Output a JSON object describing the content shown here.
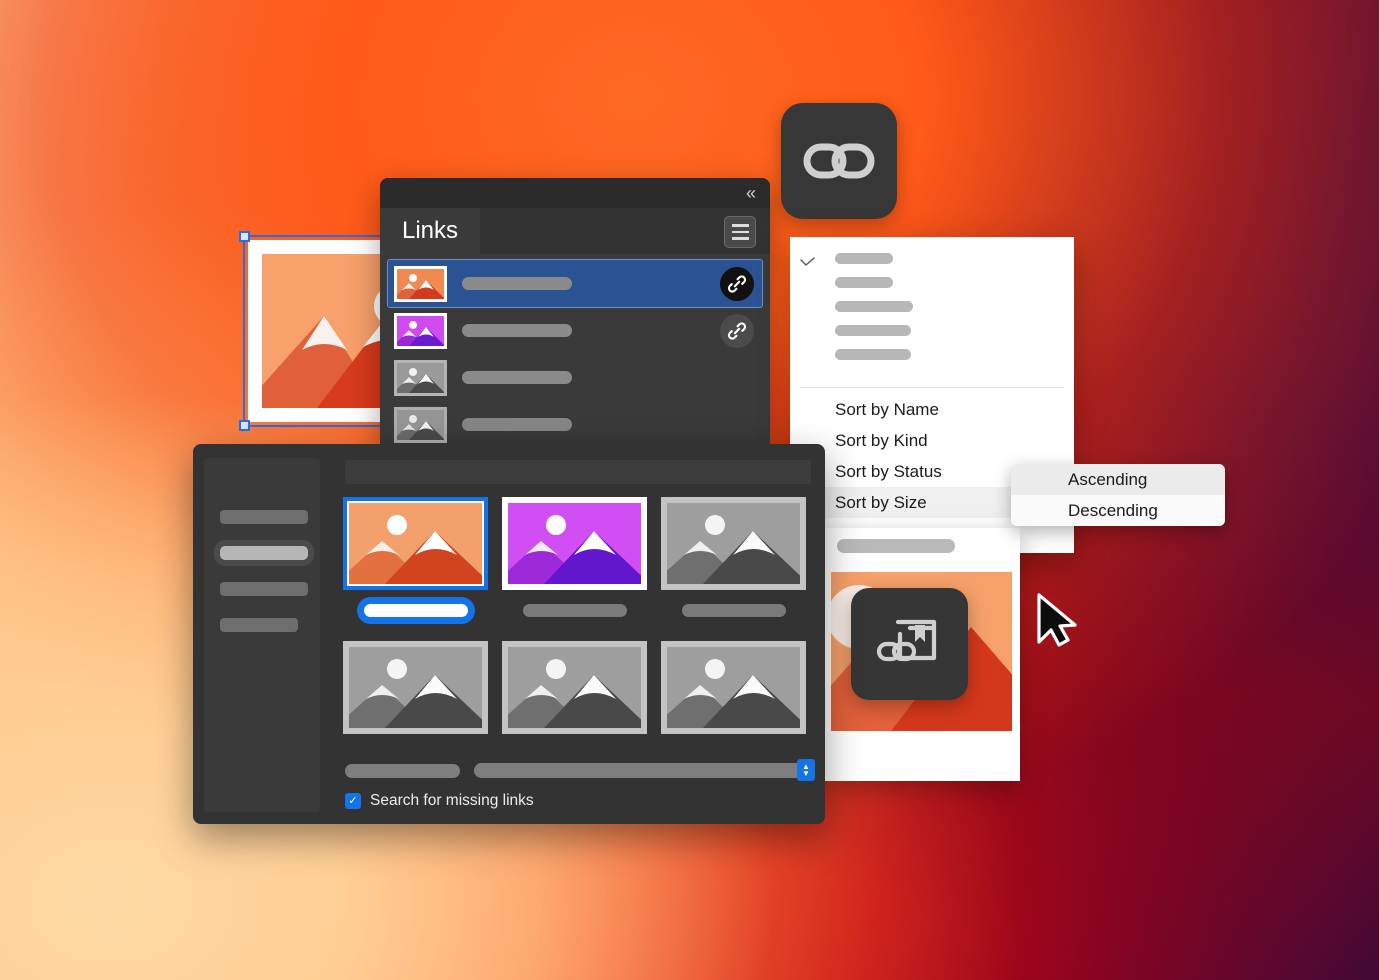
{
  "background": {
    "gradient_colors": [
      "#ffd9a2",
      "#ffa85c",
      "#ff6a25",
      "#f23a12",
      "#c80d10",
      "#8c0420",
      "#3d0938"
    ]
  },
  "links_panel": {
    "title": "Links",
    "collapse_icon": "double-chevron-left",
    "menu_icon": "hamburger-menu",
    "rows": [
      {
        "thumb": "image-orange",
        "name": "",
        "badge_icon": "link-chain",
        "selected": true
      },
      {
        "thumb": "image-purple",
        "name": "",
        "badge_icon": "link-chain",
        "selected": false
      },
      {
        "thumb": "image-gray",
        "name": "",
        "badge_icon": "",
        "selected": false
      }
    ]
  },
  "app_icon": {
    "icon": "link-chain-icon"
  },
  "relink_icon": {
    "icon": "relink-placed-image-icon"
  },
  "sort_menu": {
    "check_icon": "checkmark",
    "skeleton_rows": 5,
    "items": [
      {
        "label": "Sort by Name",
        "hover": false
      },
      {
        "label": "Sort by Kind",
        "hover": false
      },
      {
        "label": "Sort by Status",
        "hover": false
      },
      {
        "label": "Sort by Size",
        "hover": true
      }
    ],
    "footer_rows": 1
  },
  "submenu": {
    "items": [
      {
        "label": "Ascending",
        "highlighted": true
      },
      {
        "label": "Descending",
        "highlighted": false
      }
    ]
  },
  "grid_panel": {
    "sidebar_items": [
      {
        "selected": false,
        "short": false
      },
      {
        "selected": true,
        "short": false
      },
      {
        "selected": false,
        "short": false
      },
      {
        "selected": false,
        "short": true
      }
    ],
    "thumbnails": [
      {
        "kind": "image-orange",
        "selected": true,
        "label_selected": true
      },
      {
        "kind": "image-purple",
        "selected": false,
        "label_selected": false
      },
      {
        "kind": "image-gray",
        "selected": false,
        "label_selected": false
      },
      {
        "kind": "image-gray",
        "selected": false,
        "label_selected": false
      },
      {
        "kind": "image-gray",
        "selected": false,
        "label_selected": false
      },
      {
        "kind": "image-gray",
        "selected": false,
        "label_selected": false
      }
    ],
    "stepper_icon": "up-down-arrows",
    "checkbox": {
      "label": "Search for missing links",
      "checked": true,
      "check_glyph": "✓",
      "accent": "#1473e6"
    }
  },
  "right_card": {
    "caption": "",
    "image": "image-orange"
  },
  "artboard": {
    "image": "image-orange",
    "selected": true
  },
  "cursor": {
    "icon": "arrow-pointer"
  }
}
